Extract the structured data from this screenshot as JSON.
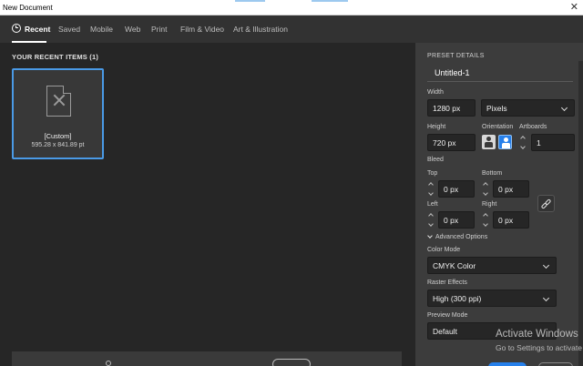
{
  "window": {
    "title": "New Document"
  },
  "tabs": [
    {
      "label": "Recent"
    },
    {
      "label": "Saved"
    },
    {
      "label": "Mobile"
    },
    {
      "label": "Web"
    },
    {
      "label": "Print"
    },
    {
      "label": "Film & Video"
    },
    {
      "label": "Art & Illustration"
    }
  ],
  "recent": {
    "heading": "YOUR RECENT ITEMS  (1)",
    "items": [
      {
        "name": "[Custom]",
        "size": "595.28 x 841.89 pt"
      }
    ]
  },
  "preset": {
    "heading": "PRESET DETAILS",
    "name": "Untitled-1",
    "width_label": "Width",
    "width_value": "1280 px",
    "unit": "Pixels",
    "height_label": "Height",
    "height_value": "720 px",
    "orientation_label": "Orientation",
    "artboards_label": "Artboards",
    "artboards_value": "1",
    "bleed_label": "Bleed",
    "top_label": "Top",
    "top_value": "0 px",
    "bottom_label": "Bottom",
    "bottom_value": "0 px",
    "left_label": "Left",
    "left_value": "0 px",
    "right_label": "Right",
    "right_value": "0 px",
    "advanced_label": "Advanced Options",
    "color_mode_label": "Color Mode",
    "color_mode_value": "CMYK Color",
    "raster_label": "Raster Effects",
    "raster_value": "High (300 ppi)",
    "preview_label": "Preview Mode",
    "preview_value": "Default"
  },
  "watermark": {
    "title": "Activate Windows",
    "subtitle": "Go to Settings to activate"
  },
  "colors": {
    "accent": "#2680eb",
    "card_border": "#4a9ae6",
    "panel_bg": "#3c3c3c",
    "main_bg": "#262626"
  }
}
